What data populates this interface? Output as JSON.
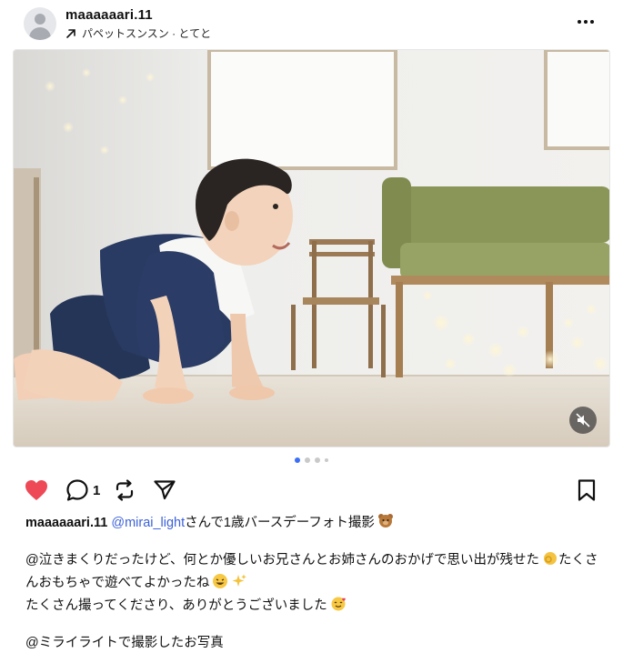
{
  "post": {
    "username": "maaaaaari.11",
    "subtitle": "パペットスンスン · とてと",
    "likes_count": "1"
  },
  "carousel": {
    "total": 4,
    "active": 0
  },
  "caption": {
    "username": "maaaaaari.11",
    "mention": "@mirai_light",
    "line1_rest": "さんで1歳バースデーフォト撮影",
    "line2": "@泣きまくりだったけど、何とか優しいお兄さんとお姉さんのおかげで思い出が残せた",
    "line2_tail": "たくさ",
    "line3": "んおもちゃで遊べてよかったね",
    "line4": "たくさん撮ってくださり、ありがとうございました",
    "line5": "@ミライライトで撮影したお写真"
  },
  "colors": {
    "like": "#ed4956",
    "mention": "#3c61d8",
    "dot_active": "#3b6ff5"
  }
}
